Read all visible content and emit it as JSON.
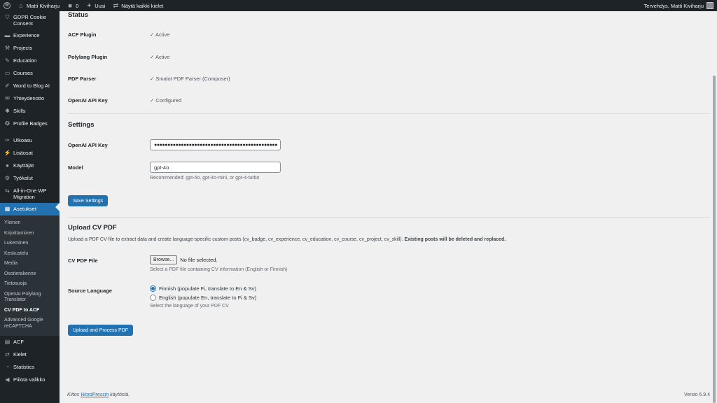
{
  "adminbar": {
    "site_name": "Matti Kiviharju",
    "comments_count": "0",
    "new_label": "Uusi",
    "languages_label": "Näytä kaikki kielet",
    "greeting": "Tervehdys, Matti Kiviharju"
  },
  "sidebar": {
    "items_top": [
      {
        "label": "GDPR Cookie Consent",
        "icon": "shield-icon"
      },
      {
        "label": "Experience",
        "icon": "briefcase-icon"
      },
      {
        "label": "Projects",
        "icon": "hammer-icon"
      },
      {
        "label": "Education",
        "icon": "pin-icon"
      },
      {
        "label": "Courses",
        "icon": "folder-icon"
      },
      {
        "label": "Word to Blog AI",
        "icon": "pencil-icon"
      },
      {
        "label": "Yhteydenotto",
        "icon": "mail-icon"
      },
      {
        "label": "Skills",
        "icon": "settings-icon"
      },
      {
        "label": "Profile Badges",
        "icon": "award-icon"
      }
    ],
    "items_mid": [
      {
        "label": "Ulkoasu",
        "icon": "brush-icon"
      },
      {
        "label": "Lisäosat",
        "icon": "plugin-icon"
      },
      {
        "label": "Käyttäjät",
        "icon": "user-icon"
      },
      {
        "label": "Työkalut",
        "icon": "wrench-icon"
      },
      {
        "label": "All-in-One WP Migration",
        "icon": "migration-icon"
      },
      {
        "label": "Asetukset",
        "icon": "settings-sliders-icon"
      }
    ],
    "submenu": [
      {
        "label": "Yleinen"
      },
      {
        "label": "Kirjoittaminen"
      },
      {
        "label": "Lukeminen"
      },
      {
        "label": "Keskustelu"
      },
      {
        "label": "Media"
      },
      {
        "label": "Osoiterakenne"
      },
      {
        "label": "Tietosuoja"
      },
      {
        "label": "OpenAI Polylang Translator"
      },
      {
        "label": "CV PDF to ACF"
      },
      {
        "label": "Advanced Google reCAPTCHA"
      }
    ],
    "items_bottom": [
      {
        "label": "ACF",
        "icon": "grid-icon"
      },
      {
        "label": "Kielet",
        "icon": "translation-icon"
      },
      {
        "label": "Statistics",
        "icon": "stats-icon"
      },
      {
        "label": "Piilota valikko",
        "icon": "collapse-icon"
      }
    ]
  },
  "status": {
    "title": "Status",
    "rows": [
      {
        "label": "ACF Plugin",
        "value": "✓ Active"
      },
      {
        "label": "Polylang Plugin",
        "value": "✓ Active"
      },
      {
        "label": "PDF Parser",
        "value": "✓ Smalot PDF Parser (Composer)"
      },
      {
        "label": "OpenAI API Key",
        "value": "✓ Configured"
      }
    ]
  },
  "settings": {
    "title": "Settings",
    "api_key_label": "OpenAI API Key",
    "api_key_value": "●●●●●●●●●●●●●●●●●●●●●●●●●●●●●●●●●●●●●●●●●●●●●●",
    "model_label": "Model",
    "model_value": "gpt-4o",
    "model_desc": "Recommended: gpt-4o, gpt-4o-mini, or gpt-4-turbo",
    "save_button": "Save Settings"
  },
  "upload": {
    "title": "Upload CV PDF",
    "intro": "Upload a PDF CV file to extract data and create language-specific custom posts (cv_badge, cv_experience, cv_education, cv_course, cv_project, cv_skill).",
    "intro_bold": "Existing posts will be deleted and replaced.",
    "file_label": "CV PDF File",
    "browse_label": "Browse...",
    "no_file": "No file selected.",
    "file_desc": "Select a PDF file containing CV information (English or Finnish)",
    "lang_label": "Source Language",
    "lang_option_fi": "Finnish (populate Fi, translate to En & Sv)",
    "lang_option_en": "English (populate En, translate to Fi & Sv)",
    "lang_desc": "Select the language of your PDF CV",
    "upload_button": "Upload and Process PDF"
  },
  "footer": {
    "thanks_prefix": "Kiitos",
    "thanks_link": "WordPressin",
    "thanks_suffix": "käytöstä.",
    "version": "Versio 6.9.4"
  }
}
